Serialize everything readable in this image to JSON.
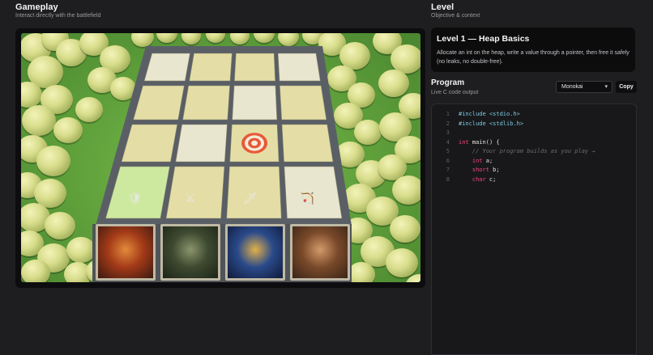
{
  "gameplay": {
    "title": "Gameplay",
    "subtitle": "Interact directly with the battlefield",
    "cards": [
      {
        "name": "siege-catapult-card",
        "colors": [
          "#3a1a10",
          "#a33a18",
          "#e28a3a"
        ]
      },
      {
        "name": "hooded-reaper-card",
        "colors": [
          "#1c2418",
          "#3e4a30",
          "#8a946c"
        ]
      },
      {
        "name": "goblin-mage-card",
        "colors": [
          "#101a3a",
          "#2a4a8a",
          "#e2b04a"
        ]
      },
      {
        "name": "barbarian-warrior-card",
        "colors": [
          "#3a2418",
          "#7a4a2a",
          "#d49a6a"
        ]
      }
    ],
    "units": [
      "🛡",
      "⚔",
      "🗡",
      "🏹"
    ]
  },
  "level": {
    "heading": "Level",
    "subheading": "Objective & context",
    "title": "Level 1 — Heap Basics",
    "description": "Allocate an int on the heap, write a value through a pointer, then free it safely (no leaks, no double-free)."
  },
  "program": {
    "heading": "Program",
    "subheading": "Live C code output",
    "theme_value": "Monokai",
    "copy_label": "Copy",
    "lines": [
      {
        "n": "1",
        "parts": [
          {
            "t": "#include <stdio.h>",
            "c": "pre"
          }
        ]
      },
      {
        "n": "2",
        "parts": [
          {
            "t": "#include <stdlib.h>",
            "c": "pre"
          }
        ]
      },
      {
        "n": "3",
        "parts": []
      },
      {
        "n": "4",
        "parts": [
          {
            "t": "int",
            "c": "kw"
          },
          {
            "t": " main() {",
            "c": "tx"
          }
        ]
      },
      {
        "n": "5",
        "parts": [
          {
            "t": "    // Your program builds as you play →",
            "c": "cm"
          }
        ]
      },
      {
        "n": "6",
        "parts": [
          {
            "t": "    ",
            "c": "tx"
          },
          {
            "t": "int",
            "c": "kw"
          },
          {
            "t": " a;",
            "c": "tx"
          }
        ]
      },
      {
        "n": "7",
        "parts": [
          {
            "t": "    ",
            "c": "tx"
          },
          {
            "t": "short",
            "c": "kw"
          },
          {
            "t": " b;",
            "c": "tx"
          }
        ]
      },
      {
        "n": "8",
        "parts": [
          {
            "t": "    ",
            "c": "tx"
          },
          {
            "t": "char",
            "c": "kw"
          },
          {
            "t": " c;",
            "c": "tx"
          }
        ]
      }
    ]
  },
  "colors": {
    "background": "#1e1e20",
    "grass": "#6aa843",
    "tile": "#e4dea6",
    "stone_border": "#5a5f66",
    "keyword": "#f0467a",
    "preprocessor": "#7ec8e3",
    "comment": "#6b6f6a"
  }
}
